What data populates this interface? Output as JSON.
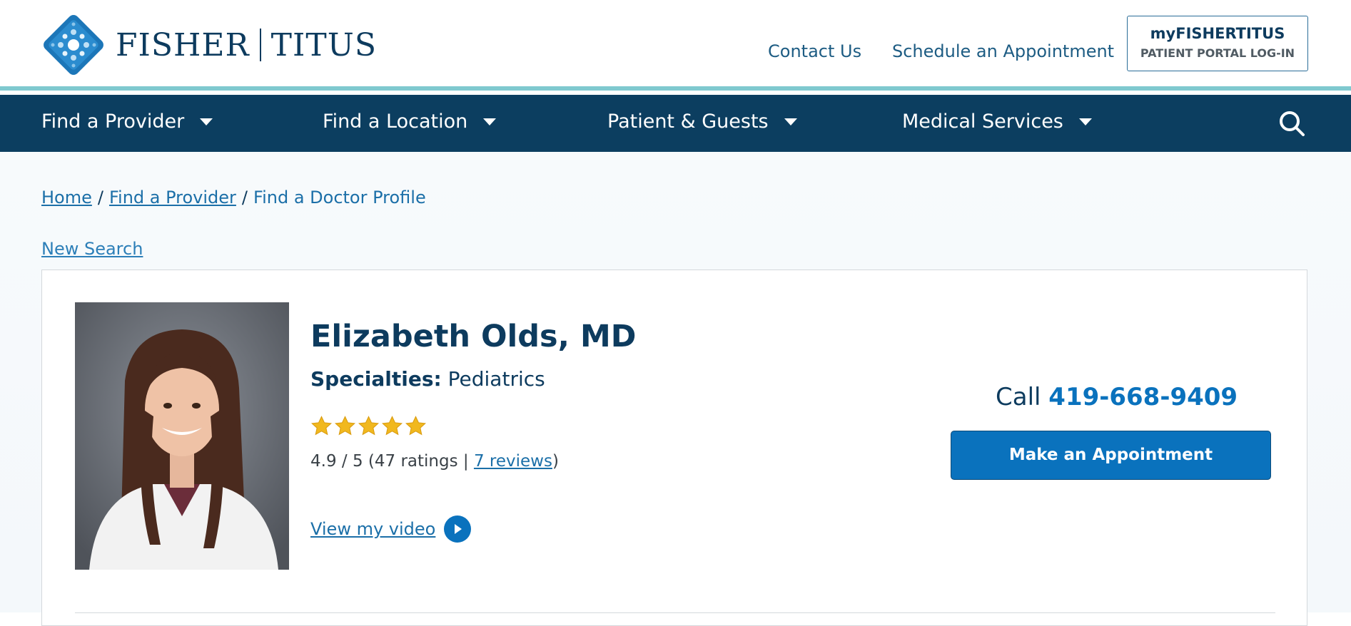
{
  "brand": {
    "name_left": "FISHER",
    "name_right": "TITUS",
    "logo_icon": "diamond-dots-logo-icon",
    "colors": {
      "primary": "#0d3b5e",
      "accent": "#0a72bd",
      "teal": "#7fc9cf"
    }
  },
  "top_links": {
    "contact": "Contact Us",
    "schedule": "Schedule an Appointment"
  },
  "portal": {
    "title": "myFISHERTITUS",
    "subtitle": "PATIENT PORTAL LOG-IN"
  },
  "nav": {
    "items": [
      {
        "label": "Find a Provider"
      },
      {
        "label": "Find a Location"
      },
      {
        "label": "Patient & Guests"
      },
      {
        "label": "Medical Services"
      }
    ],
    "search_icon": "search-icon"
  },
  "breadcrumb": {
    "home": "Home",
    "find_provider": "Find a Provider",
    "current": "Find a Doctor Profile"
  },
  "new_search": "New Search",
  "provider": {
    "name": "Elizabeth Olds, MD",
    "specialties_label": "Specialties:",
    "specialties_value": "Pediatrics",
    "stars": 5,
    "rating_prefix": "4.9 / 5 (47 ratings | ",
    "reviews_link": "7 reviews",
    "rating_suffix": ")",
    "video_link": "View my video",
    "call_label": "Call",
    "phone": "419-668-9409",
    "appointment_button": "Make an Appointment"
  }
}
